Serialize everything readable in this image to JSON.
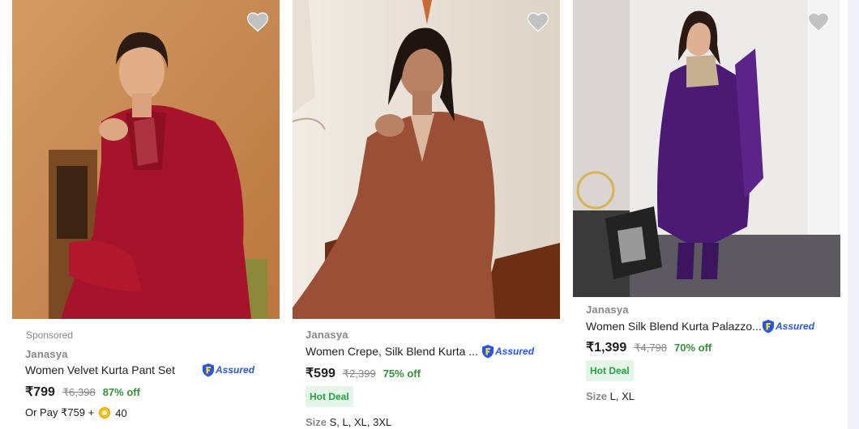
{
  "colors": {
    "green_offer": "#388e3c",
    "hot_deal_bg": "#e6f5e9",
    "assured_blue": "#2a55e5",
    "muted_text": "#878787"
  },
  "products": [
    {
      "sponsored": "Sponsored",
      "brand": "Janasya",
      "title": "Women Velvet Kurta Pant Set",
      "assured": "Assured",
      "price": "₹799",
      "mrp": "₹6,398",
      "discount": "87% off",
      "pay_later_prefix": "Or Pay ₹759 +",
      "coins": "40",
      "image_icon": "woman-red-velvet-kurta-photo",
      "wishlist_icon": "heart-icon"
    },
    {
      "brand": "Janasya",
      "title": "Women Crepe, Silk Blend Kurta ...",
      "assured": "Assured",
      "price": "₹599",
      "mrp": "₹2,399",
      "discount": "75% off",
      "hot_deal": "Hot Deal",
      "size_label": "Size",
      "sizes": "S, L, XL, 3XL",
      "image_icon": "woman-rust-silk-kurta-photo",
      "wishlist_icon": "heart-icon"
    },
    {
      "brand": "Janasya",
      "title": "Women Silk Blend Kurta Palazzo...",
      "assured": "Assured",
      "price": "₹1,399",
      "mrp": "₹4,798",
      "discount": "70% off",
      "hot_deal": "Hot Deal",
      "size_label": "Size",
      "sizes": "L, XL",
      "image_icon": "woman-purple-kurta-palazzo-photo",
      "wishlist_icon": "heart-icon"
    }
  ]
}
